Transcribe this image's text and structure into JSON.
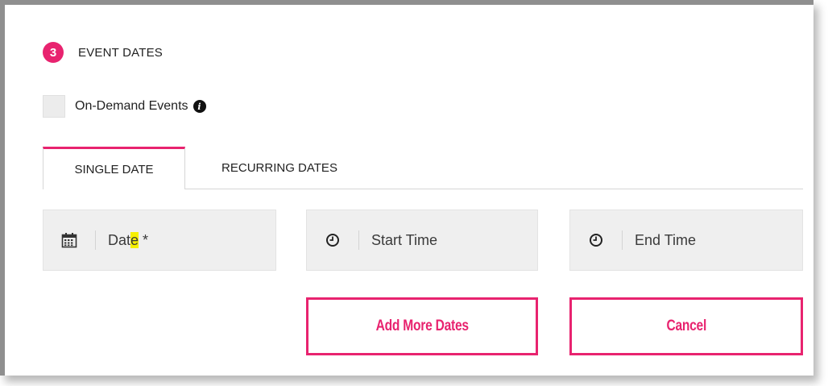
{
  "section": {
    "step_number": "3",
    "title": "EVENT DATES"
  },
  "on_demand": {
    "label": "On-Demand Events",
    "checked": false,
    "info_icon": "info-circle-icon"
  },
  "tabs": [
    {
      "label": "SINGLE DATE",
      "active": true
    },
    {
      "label": "RECURRING DATES",
      "active": false
    }
  ],
  "fields": {
    "date": {
      "placeholder_main": "Dat",
      "placeholder_highlight": "e",
      "placeholder_suffix": " *",
      "icon": "calendar-icon"
    },
    "start_time": {
      "placeholder": "Start Time",
      "icon": "clock-icon"
    },
    "end_time": {
      "placeholder": "End Time",
      "icon": "clock-icon"
    }
  },
  "buttons": {
    "add_more": "Add More Dates",
    "cancel": "Cancel"
  },
  "colors": {
    "accent": "#e8236f",
    "field_bg": "#efefef",
    "highlight": "#f6f000"
  }
}
